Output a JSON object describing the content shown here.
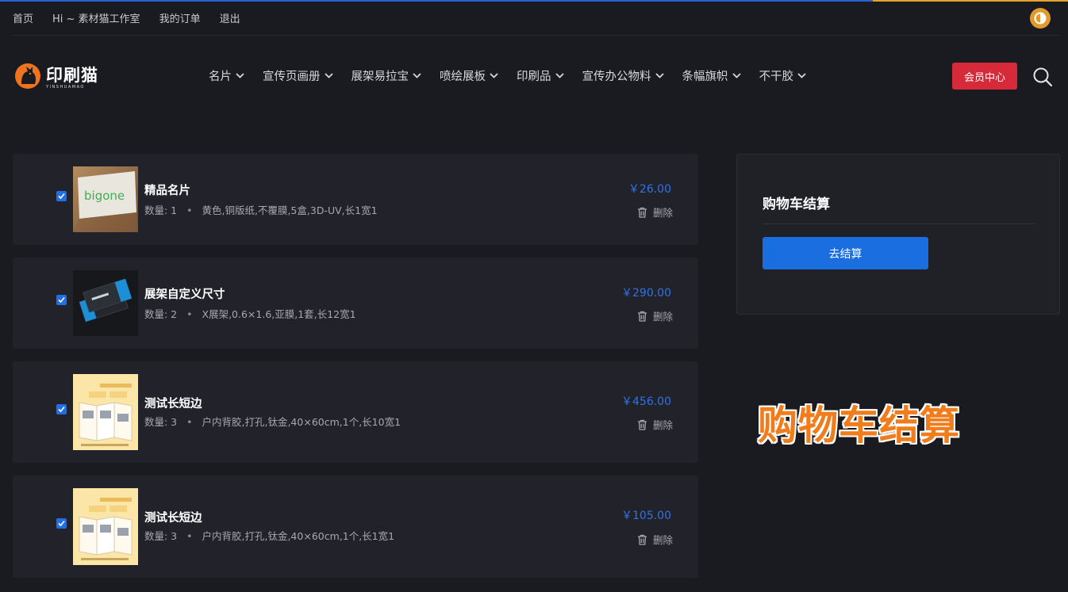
{
  "topbar": {
    "links": [
      "首页",
      "Hi ~ 素材猫工作室",
      "我的订单",
      "退出"
    ]
  },
  "logo": {
    "text": "印刷猫",
    "sub": "YINSHUAMAO"
  },
  "nav": {
    "items": [
      "名片",
      "宣传页画册",
      "展架易拉宝",
      "喷绘展板",
      "印刷品",
      "宣传办公物料",
      "条幅旗帜",
      "不干胶"
    ],
    "member_label": "会员中心"
  },
  "cart": {
    "items": [
      {
        "title": "精品名片",
        "qty": "数量: 1",
        "spec": "黄色,铜版纸,不覆膜,5盒,3D-UV,长1宽1",
        "price": "￥26.00",
        "delete_label": "删除",
        "checked": true,
        "thumb": "card-photo-bigone"
      },
      {
        "title": "展架自定义尺寸",
        "qty": "数量: 2",
        "spec": "X展架,0.6×1.6,亚膜,1套,长12宽1",
        "price": "￥290.00",
        "delete_label": "删除",
        "checked": true,
        "thumb": "dark-business-cards"
      },
      {
        "title": "测试长短边",
        "qty": "数量: 3",
        "spec": "户内背胶,打孔,钛金,40×60cm,1个,长10宽1",
        "price": "￥456.00",
        "delete_label": "删除",
        "checked": true,
        "thumb": "yellow-brochure"
      },
      {
        "title": "测试长短边",
        "qty": "数量: 3",
        "spec": "户内背胶,打孔,钛金,40×60cm,1个,长1宽1",
        "price": "￥105.00",
        "delete_label": "删除",
        "checked": true,
        "thumb": "yellow-brochure"
      }
    ]
  },
  "checkout": {
    "title": "购物车结算",
    "button_label": "去结算"
  },
  "caption": "购物车结算",
  "colors": {
    "background": "#1a1b20",
    "card": "#22232a",
    "accent_blue": "#1a6ee0",
    "price_blue": "#2f72e6",
    "member_red": "#d6293a",
    "caption_orange": "#f07c1c",
    "theme_toggle": "#e39a2d"
  }
}
